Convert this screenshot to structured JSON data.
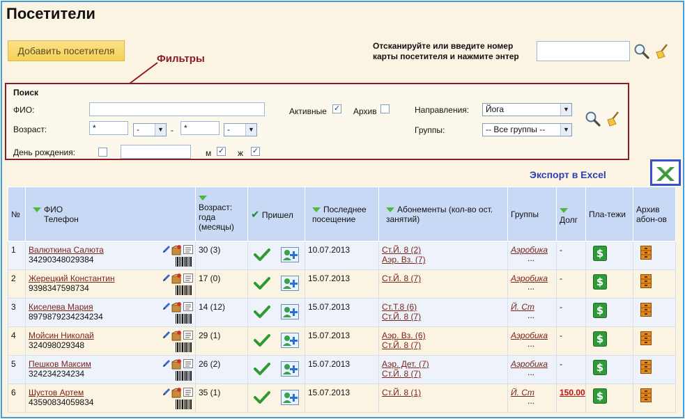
{
  "page": {
    "title": "Посетители",
    "add_visitor_label": "Добавить посетителя",
    "scan_label": "Отсканируйте или введите номер карты посетителя и нажмите энтер",
    "scan_value": "",
    "filters_callout": "Фильтры",
    "export_callout": "Экспорт в Excel"
  },
  "filters": {
    "heading": "Поиск",
    "fio_label": "ФИО:",
    "fio_value": "",
    "age_label": "Возраст:",
    "age_from": "*",
    "age_from_unit": "-",
    "age_sep": "-",
    "age_to": "*",
    "age_to_unit": "-",
    "birthday_label": "День рождения:",
    "birthday_checked": false,
    "birthday_value": "",
    "male_label": "м",
    "male_checked": true,
    "female_label": "ж",
    "female_checked": true,
    "active_label": "Активные",
    "active_checked": true,
    "archive_label": "Архив",
    "archive_checked": false,
    "directions_label": "Направления:",
    "directions_value": "Йога",
    "groups_label": "Группы:",
    "groups_value": "-- Все группы --"
  },
  "table": {
    "headers": {
      "num": "№",
      "fio": "ФИО",
      "phone": "Телефон",
      "age": "Возраст: года (месяцы)",
      "came": "Пришел",
      "last_visit": "Последнее посещение",
      "subscriptions": "Абонементы (кол-во ост. занятий)",
      "groups": "Группы",
      "debt": "Долг",
      "payments": "Пла-тежи",
      "archive": "Архив абон-ов"
    },
    "rows": [
      {
        "num": "1",
        "name": "Валюткина Салюта",
        "phone": "34290348029384",
        "age": "30 (3)",
        "last": "10.07.2013",
        "subs": [
          "Ст.Й. 8 (2)",
          "Аэр. Вз. (7)"
        ],
        "group": "Аэробика",
        "more": "...",
        "debt": "-"
      },
      {
        "num": "2",
        "name": "Жерецкий Константин",
        "phone": "9398347598734",
        "age": "17 (0)",
        "last": "15.07.2013",
        "subs": [
          "Ст.Й. 8 (7)"
        ],
        "group": "Аэробика",
        "more": "...",
        "debt": "-"
      },
      {
        "num": "3",
        "name": "Киселева Мария",
        "phone": "8979879234234234",
        "age": "14 (12)",
        "last": "15.07.2013",
        "subs": [
          "Ст.Т.8 (6)",
          "Ст.Й. 8 (7)"
        ],
        "group": "Й. Ст",
        "more": "...",
        "debt": "-"
      },
      {
        "num": "4",
        "name": "Мойсин Николай",
        "phone": "324098029348",
        "age": "29 (1)",
        "last": "15.07.2013",
        "subs": [
          "Аэр. Вз. (6)",
          "Ст.Й. 8 (7)"
        ],
        "group": "Аэробика",
        "more": "...",
        "debt": "-"
      },
      {
        "num": "5",
        "name": "Пешков Максим",
        "phone": "324234234234",
        "age": "26 (2)",
        "last": "15.07.2013",
        "subs": [
          "Аэр. Дет. (7)",
          "Ст.Й. 8 (7)"
        ],
        "group": "Аэробика",
        "more": "...",
        "debt": "-"
      },
      {
        "num": "6",
        "name": "Шустов Артем",
        "phone": "43590834059834",
        "age": "35 (1)",
        "last": "15.07.2013",
        "subs": [
          "Ст.Й. 8 (1)"
        ],
        "group": "Й. Ст",
        "more": "...",
        "debt": "150.00"
      }
    ]
  },
  "colors": {
    "accent_red": "#8e1b22",
    "header_blue": "#c8d9f6",
    "link": "#7a2418",
    "export_blue": "#2a3fb2"
  }
}
